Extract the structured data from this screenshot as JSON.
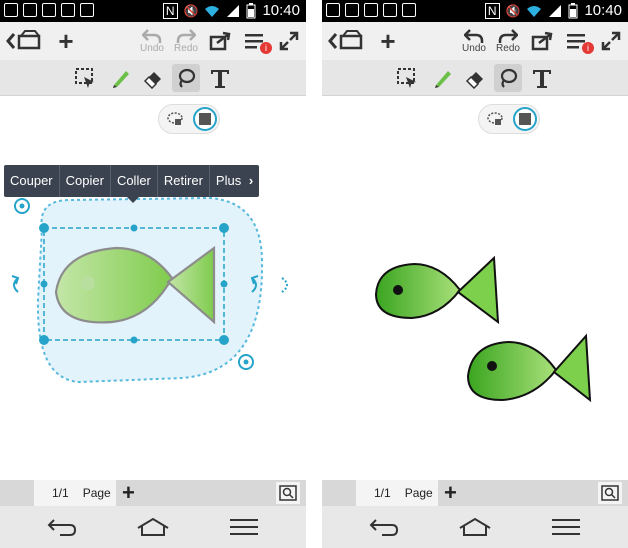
{
  "status_bar": {
    "time": "10:40",
    "nfc_text": "N"
  },
  "toolbar": {
    "undo_label": "Undo",
    "redo_label": "Redo",
    "notification_badge": "i"
  },
  "context_menu": {
    "items": [
      "Couper",
      "Copier",
      "Coller",
      "Retirer",
      "Plus"
    ]
  },
  "page_bar": {
    "page_count": "1/1",
    "page_label": "Page",
    "add_symbol": "+"
  },
  "colors": {
    "accent": "#26a3c9",
    "menu_bg": "#3b4350",
    "fish_green": "#5cbf2a",
    "badge_red": "#e53935"
  }
}
